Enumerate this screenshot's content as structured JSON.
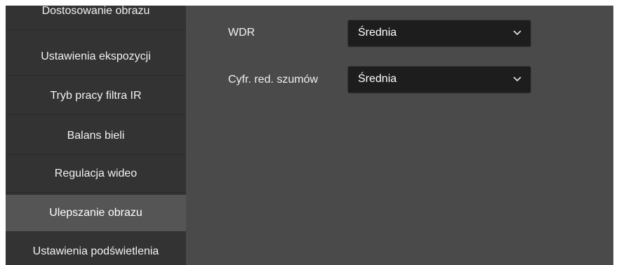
{
  "sidebar": {
    "items": [
      {
        "label": "Dostosowanie obrazu",
        "active": false
      },
      {
        "label": "Ustawienia ekspozycji",
        "active": false
      },
      {
        "label": "Tryb pracy filtra IR",
        "active": false
      },
      {
        "label": "Balans bieli",
        "active": false
      },
      {
        "label": "Regulacja wideo",
        "active": false
      },
      {
        "label": "Ulepszanie obrazu",
        "active": true
      },
      {
        "label": "Ustawienia podświetlenia",
        "active": false
      }
    ]
  },
  "form": {
    "wdr": {
      "label": "WDR",
      "value": "Średnia",
      "icon": "chevron-down-icon"
    },
    "noise_reduction": {
      "label": "Cyfr. red. szumów",
      "value": "Średnia",
      "icon": "chevron-down-icon"
    }
  },
  "colors": {
    "panel_bg": "#4a4a4a",
    "sidebar_bg": "#333333",
    "active_item_bg": "#555555",
    "select_bg": "#1d1d1d"
  }
}
